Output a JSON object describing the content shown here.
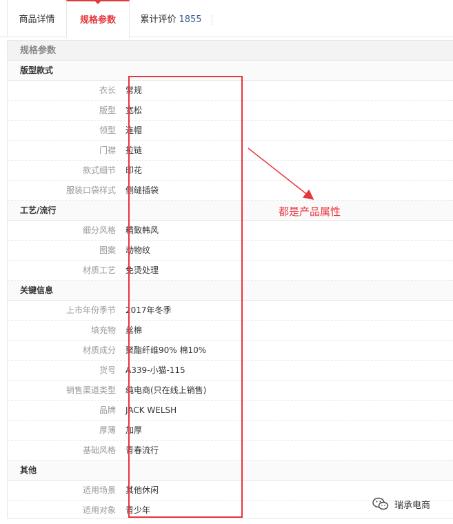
{
  "tabs": [
    {
      "label": "商品详情"
    },
    {
      "label": "规格参数"
    },
    {
      "label": "累计评价",
      "count": "1855"
    }
  ],
  "panel_title": "规格参数",
  "groups": [
    {
      "title": "版型款式",
      "rows": [
        {
          "k": "衣长",
          "v": "常规"
        },
        {
          "k": "版型",
          "v": "宽松"
        },
        {
          "k": "领型",
          "v": "连帽"
        },
        {
          "k": "门襟",
          "v": "拉链"
        },
        {
          "k": "款式细节",
          "v": "印花"
        },
        {
          "k": "服装口袋样式",
          "v": "侧缝插袋"
        }
      ]
    },
    {
      "title": "工艺/流行",
      "rows": [
        {
          "k": "细分风格",
          "v": "精致韩风"
        },
        {
          "k": "图案",
          "v": "动物纹"
        },
        {
          "k": "材质工艺",
          "v": "免烫处理"
        }
      ]
    },
    {
      "title": "关键信息",
      "rows": [
        {
          "k": "上市年份季节",
          "v": "2017年冬季"
        },
        {
          "k": "填充物",
          "v": "丝棉"
        },
        {
          "k": "材质成分",
          "v": "聚酯纤维90% 棉10%"
        },
        {
          "k": "货号",
          "v": "A339-小猫-115"
        },
        {
          "k": "销售渠道类型",
          "v": "纯电商(只在线上销售)"
        },
        {
          "k": "品牌",
          "v": "JACK WELSH"
        },
        {
          "k": "厚薄",
          "v": "加厚"
        },
        {
          "k": "基础风格",
          "v": "青春流行"
        }
      ]
    },
    {
      "title": "其他",
      "rows": [
        {
          "k": "适用场景",
          "v": "其他休闲"
        },
        {
          "k": "适用对象",
          "v": "青少年"
        }
      ]
    }
  ],
  "annotation": {
    "text": "都是产品属性",
    "color": "#e8343c"
  },
  "watermark": {
    "text": "瑞承电商",
    "icon": "wechat-icon"
  },
  "colors": {
    "accent": "#e4393c",
    "count": "#3c5d8c"
  }
}
